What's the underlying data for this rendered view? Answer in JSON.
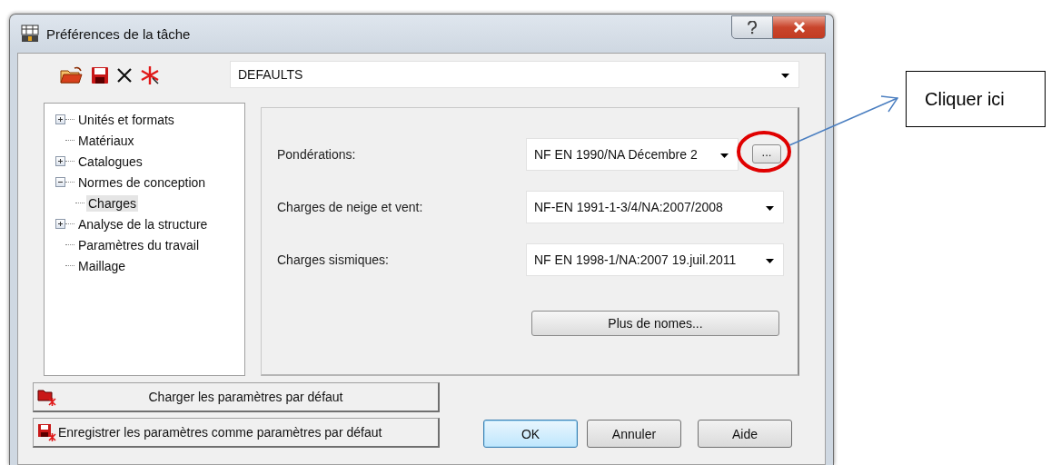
{
  "window": {
    "title": "Préférences de la tâche"
  },
  "profile": {
    "value": "DEFAULTS"
  },
  "tree": [
    {
      "label": "Unités et formats",
      "kind": "branch",
      "expanded": false,
      "selected": false
    },
    {
      "label": "Matériaux",
      "kind": "leaf",
      "selected": false
    },
    {
      "label": "Catalogues",
      "kind": "branch",
      "expanded": false,
      "selected": false
    },
    {
      "label": "Normes de conception",
      "kind": "branch",
      "expanded": true,
      "selected": false,
      "children": [
        {
          "label": "Charges",
          "kind": "leaf",
          "selected": true
        }
      ]
    },
    {
      "label": "Analyse de la structure",
      "kind": "branch",
      "expanded": false,
      "selected": false
    },
    {
      "label": "Paramètres du travail",
      "kind": "leaf",
      "selected": false
    },
    {
      "label": "Maillage",
      "kind": "leaf",
      "selected": false
    }
  ],
  "fields": [
    {
      "label": "Pondérations:",
      "value": "NF EN 1990/NA Décembre 2",
      "browse": "..."
    },
    {
      "label": "Charges de neige et vent:",
      "value": "NF-EN 1991-1-3/4/NA:2007/2008"
    },
    {
      "label": "Charges sismiques:",
      "value": "NF EN 1998-1/NA:2007 19.juil.2011"
    }
  ],
  "more_button": "Plus de nomes...",
  "default_buttons": [
    {
      "label": "Charger les paramètres par défaut",
      "kind": "load"
    },
    {
      "label": "Enregistrer les paramètres comme paramètres par défaut",
      "kind": "save"
    }
  ],
  "buttons": [
    {
      "label": "OK",
      "selected": true
    },
    {
      "label": "Annuler",
      "selected": false
    },
    {
      "label": "Aide",
      "selected": false
    }
  ],
  "callout": {
    "text": "Cliquer ici"
  }
}
